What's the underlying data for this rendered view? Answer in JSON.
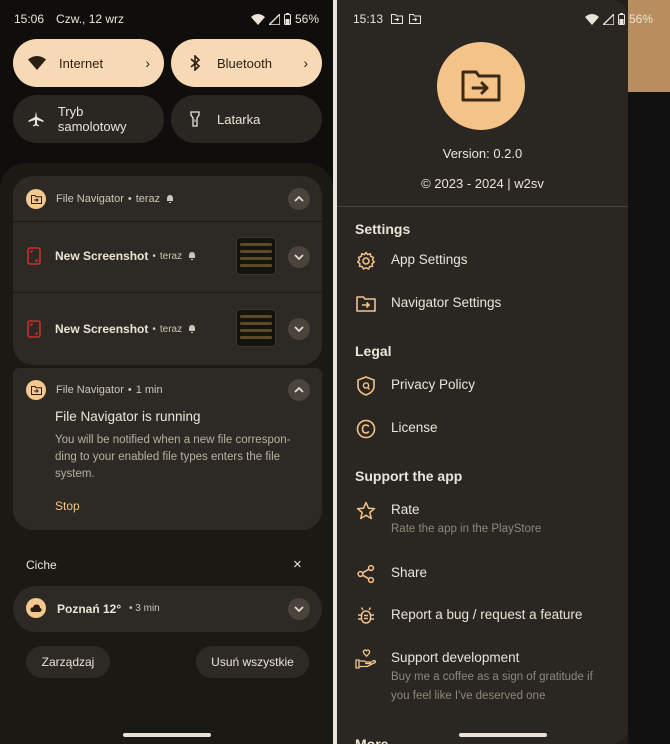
{
  "left": {
    "status": {
      "time": "15:06",
      "date": "Czw., 12 wrz",
      "battery": "56%"
    },
    "tiles": [
      {
        "label": "Internet",
        "icon": "wifi-icon",
        "active": true
      },
      {
        "label": "Bluetooth",
        "icon": "bluetooth-icon",
        "active": true
      },
      {
        "label": "Tryb samolotowy",
        "icon": "airplane-icon",
        "active": false
      },
      {
        "label": "Latarka",
        "icon": "flashlight-icon",
        "active": false
      }
    ],
    "group": {
      "app": "File Navigator",
      "time": "teraz"
    },
    "screenshots": [
      {
        "title": "New Screenshot",
        "time": "teraz"
      },
      {
        "title": "New Screenshot",
        "time": "teraz"
      }
    ],
    "running": {
      "app": "File Navigator",
      "time": "1 min",
      "title": "File Navigator is running",
      "body": "You will be notified when a new file correspon-ding to your enabled file types enters the file system.",
      "action": "Stop"
    },
    "silent": {
      "header": "Ciche"
    },
    "weather": {
      "title": "Poznań 12°",
      "time": "3 min"
    },
    "buttons": {
      "manage": "Zarządzaj",
      "clear": "Usuń wszystkie"
    }
  },
  "right": {
    "status": {
      "time": "15:13",
      "battery": "56%"
    },
    "version": "Version: 0.2.0",
    "copyright": "© 2023 - 2024 | w2sv",
    "sections": {
      "settings": "Settings",
      "legal": "Legal",
      "support": "Support the app",
      "more": "More"
    },
    "items": {
      "app_settings": "App Settings",
      "navigator_settings": "Navigator Settings",
      "privacy": "Privacy Policy",
      "license": "License",
      "rate": "Rate",
      "rate_sub": "Rate the app in the PlayStore",
      "share": "Share",
      "report": "Report a bug / request a feature",
      "support_dev": "Support development",
      "support_dev_sub": "Buy me a coffee as a sign of gratitude if you feel like I've deserved one"
    }
  },
  "colors": {
    "accent": "#f4c38a",
    "tile_active": "#f8d9b5",
    "screenshot_icon": "#c9302c"
  }
}
